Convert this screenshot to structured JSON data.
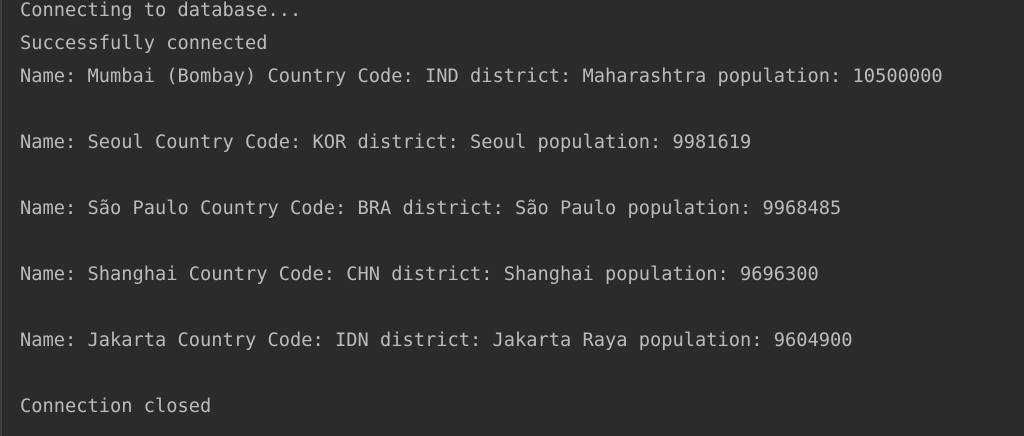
{
  "console": {
    "lines": [
      "Connecting to database...",
      "Successfully connected",
      "Name: Mumbai (Bombay) Country Code: IND district: Maharashtra population: 10500000",
      "",
      "Name: Seoul Country Code: KOR district: Seoul population: 9981619",
      "",
      "Name: São Paulo Country Code: BRA district: São Paulo population: 9968485",
      "",
      "Name: Shanghai Country Code: CHN district: Shanghai population: 9696300",
      "",
      "Name: Jakarta Country Code: IDN district: Jakarta Raya population: 9604900",
      "",
      "Connection closed"
    ]
  },
  "colors": {
    "background": "#2b2b2b",
    "text": "#bbbbbb"
  }
}
